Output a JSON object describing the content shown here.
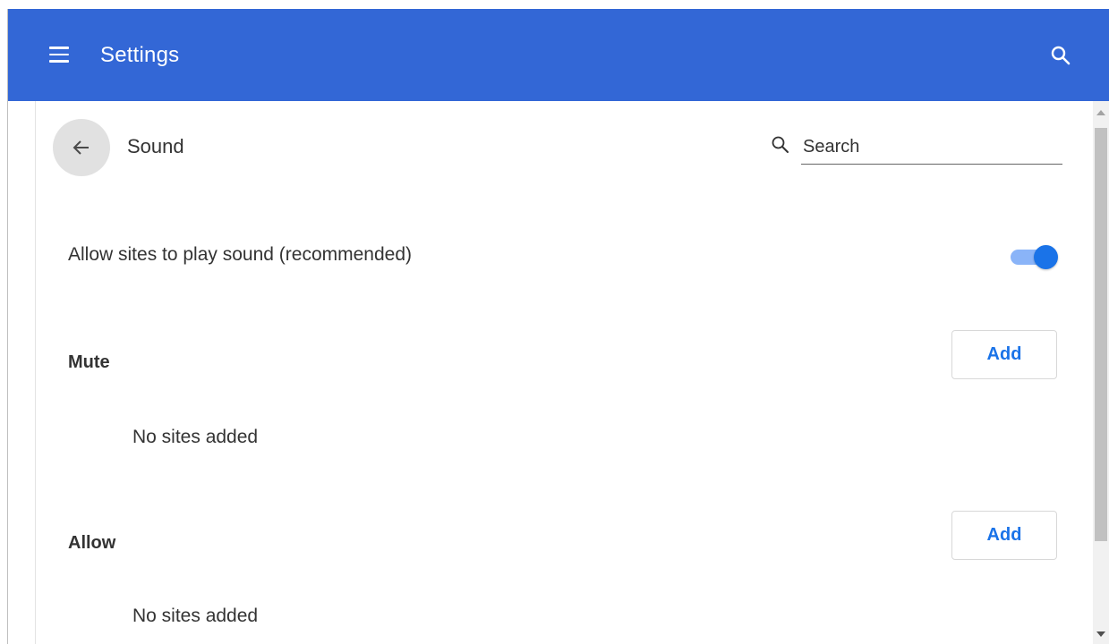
{
  "appbar": {
    "title": "Settings",
    "menu_icon": "hamburger-menu-icon",
    "search_icon": "search-icon",
    "background_color": "#3367d6"
  },
  "page": {
    "title": "Sound",
    "back_icon": "arrow-back-icon",
    "search": {
      "placeholder": "Search",
      "value": ""
    }
  },
  "settings": {
    "allow_sound": {
      "label": "Allow sites to play sound (recommended)",
      "enabled": true
    },
    "sections": [
      {
        "title": "Mute",
        "add_label": "Add",
        "empty_text": "No sites added"
      },
      {
        "title": "Allow",
        "add_label": "Add",
        "empty_text": "No sites added"
      }
    ]
  },
  "colors": {
    "accent": "#1a73e8",
    "toggle_track": "#8ab4f8"
  }
}
